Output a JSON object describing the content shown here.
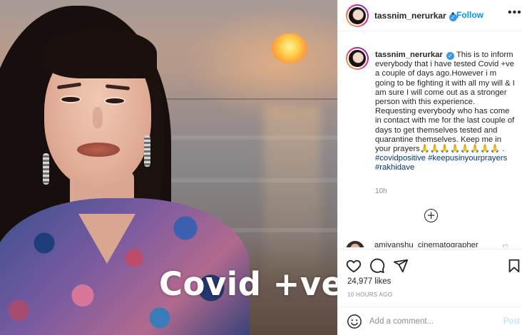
{
  "photo": {
    "overlay_text": "Covid +ve"
  },
  "header": {
    "username": "tassnim_nerurkar",
    "verified_symbol": "✓",
    "separator": "•",
    "follow_label": "Follow",
    "more_label": "•••"
  },
  "caption": {
    "username": "tassnim_nerurkar",
    "verified_symbol": "✓",
    "text": "This is to inform everybody that i have tested Covid +ve a couple of days ago.However i m going to be fighting it with all my will & I am sure I will come out as a stronger person with this experience. Requesting everybody who has come in contact with me for the last couple of days to get themselves tested and quarantine themselves. Keep me in your prayers🙏🙏🙏🙏🙏🙏🙏🙏 .",
    "hashtags": [
      "#covidpositive",
      "#keepusinyourprayers",
      "#rakhidave"
    ],
    "time_ago": "10h"
  },
  "load_more_symbol": "+",
  "next_comment": {
    "username": "amivanshu_cinematographer"
  },
  "actions": {
    "like_icon": "heart-icon",
    "comment_icon": "comment-icon",
    "share_icon": "share-icon",
    "save_icon": "bookmark-icon"
  },
  "likes_text": "24,977 likes",
  "post_time": "10 HOURS AGO",
  "comment_box": {
    "placeholder": "Add a comment...",
    "post_label": "Post"
  },
  "colors": {
    "link_blue": "#0095f6",
    "hashtag_blue": "#00376b",
    "muted": "#8e8e8e",
    "post_disabled": "#b2dffc"
  }
}
